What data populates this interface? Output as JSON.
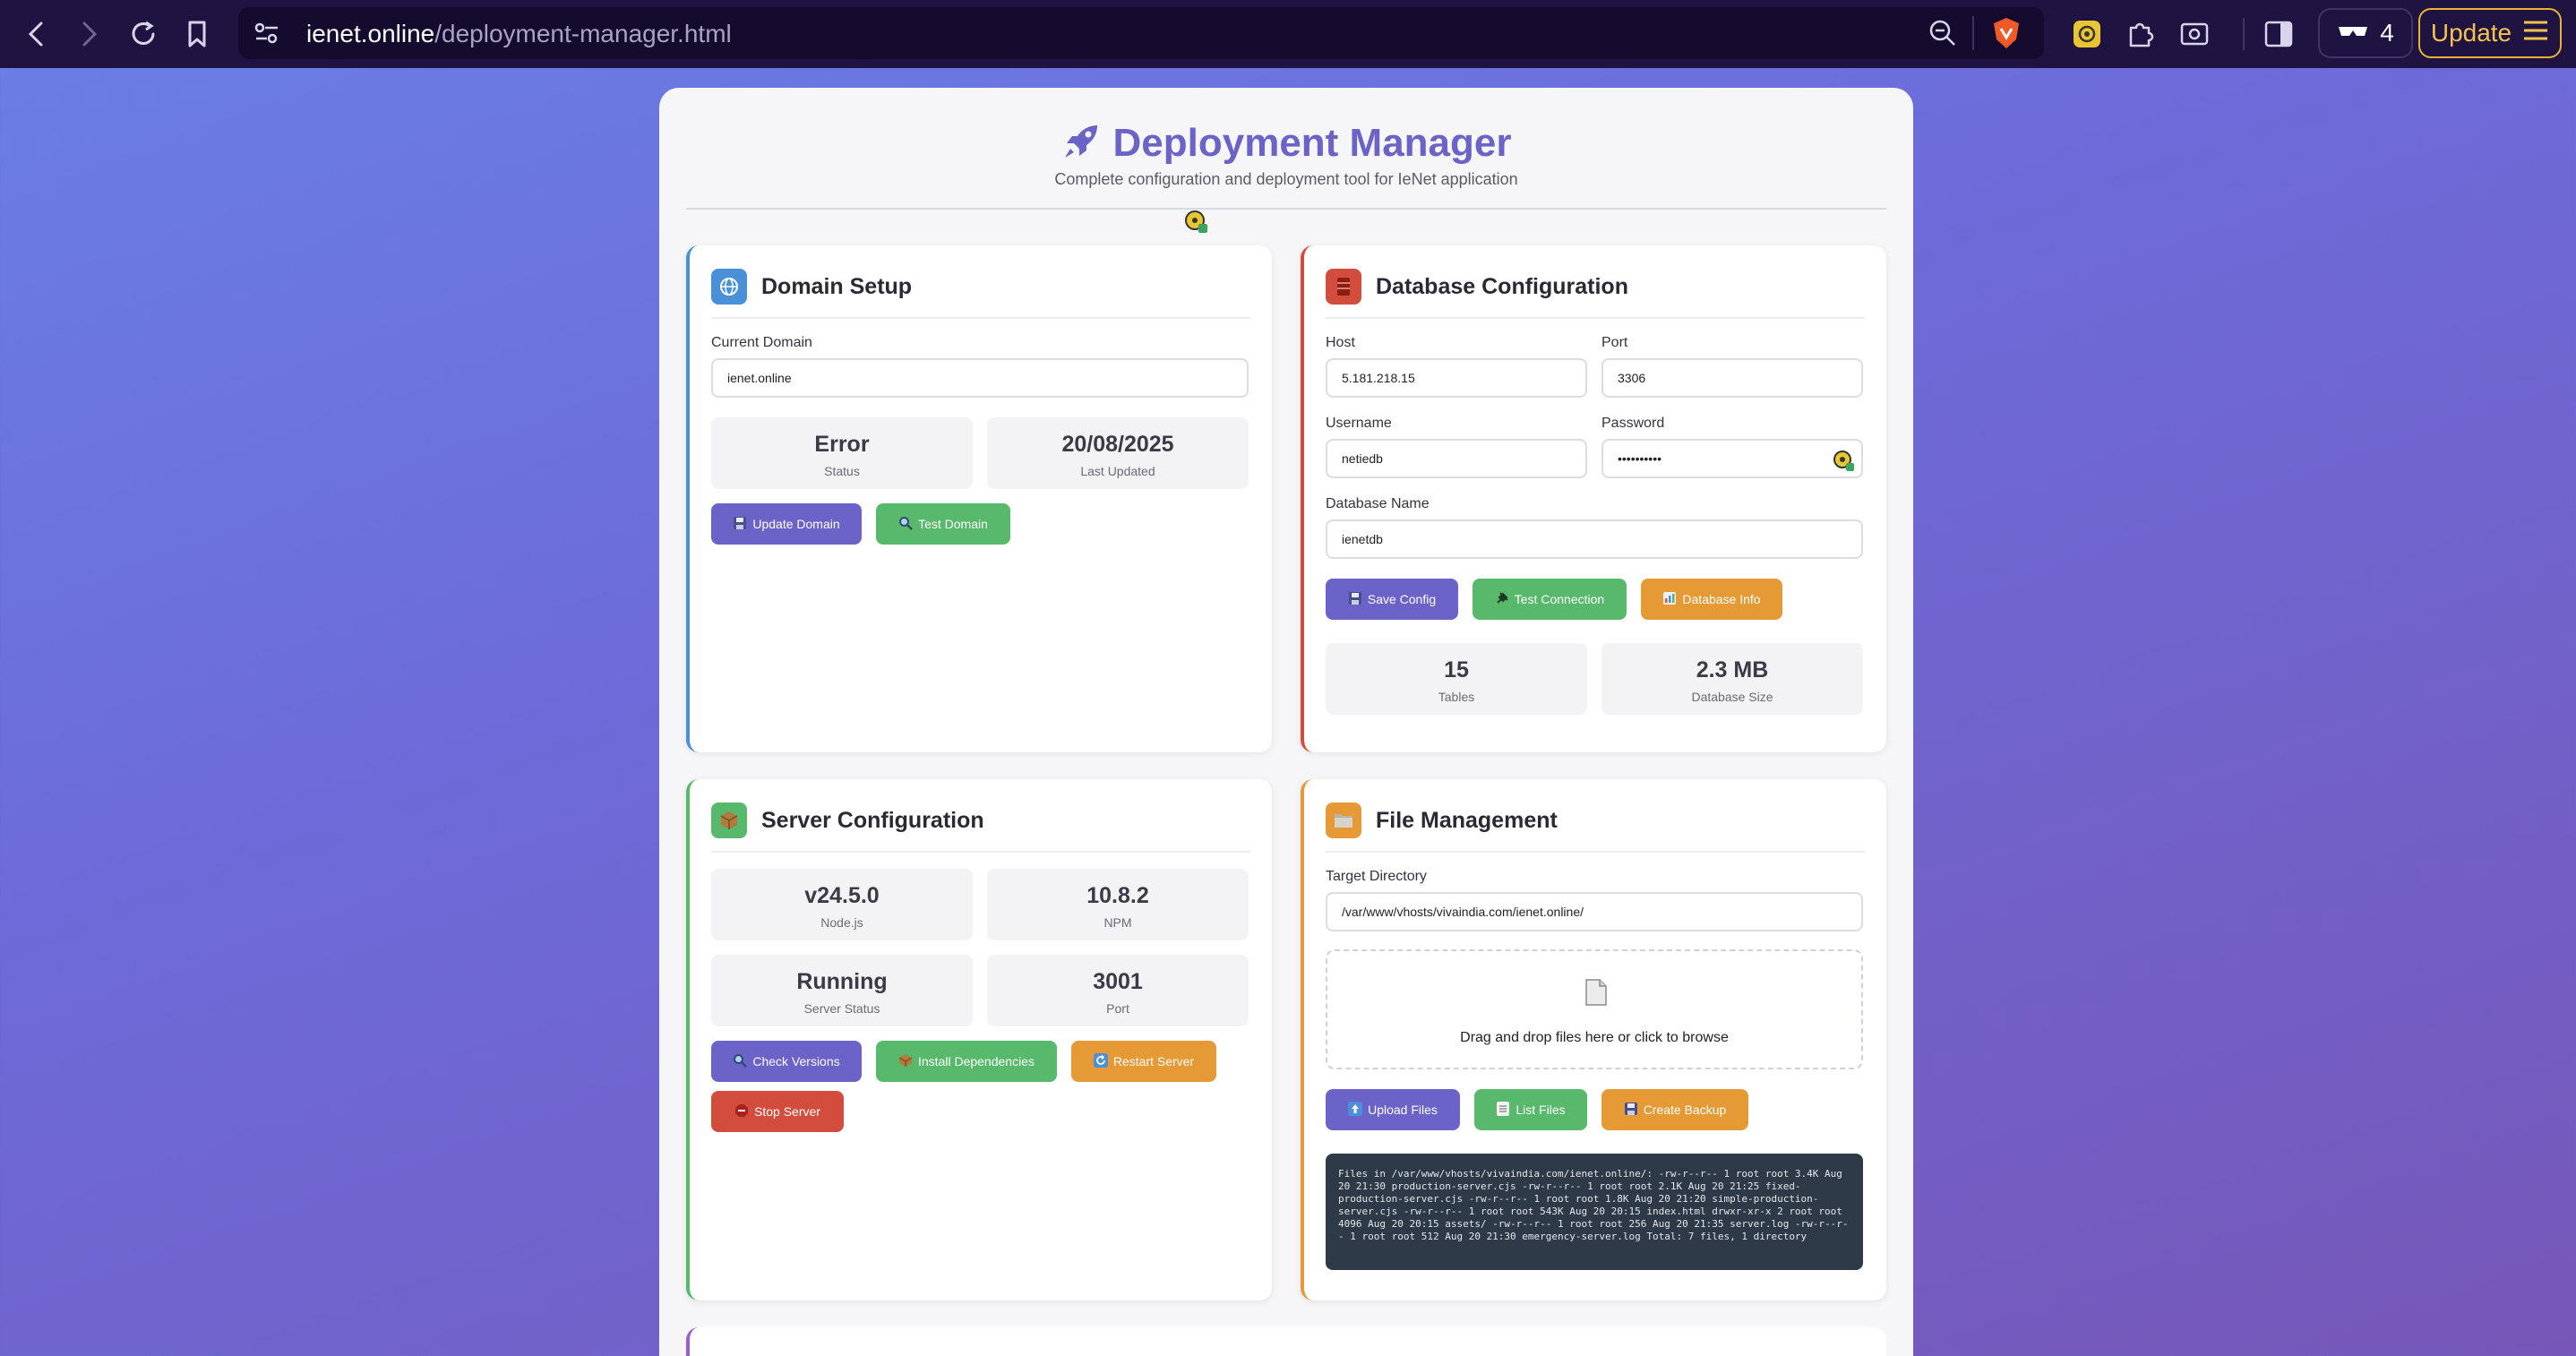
{
  "browser": {
    "url_host": "ienet.online",
    "url_path": "/deployment-manager.html",
    "glasses_count": "4",
    "update_label": "Update"
  },
  "header": {
    "title": "Deployment Manager",
    "subtitle": "Complete configuration and deployment tool for IeNet application"
  },
  "domain_setup": {
    "title": "Domain Setup",
    "current_domain_label": "Current Domain",
    "current_domain_value": "ienet.online",
    "status_value": "Error",
    "status_label": "Status",
    "updated_value": "20/08/2025",
    "updated_label": "Last Updated",
    "update_button": "Update Domain",
    "test_button": "Test Domain"
  },
  "database": {
    "title": "Database Configuration",
    "host_label": "Host",
    "host_value": "5.181.218.15",
    "port_label": "Port",
    "port_value": "3306",
    "username_label": "Username",
    "username_value": "netiedb",
    "password_label": "Password",
    "password_value": "••••••••••",
    "dbname_label": "Database Name",
    "dbname_value": "ienetdb",
    "save_button": "Save Config",
    "test_button": "Test Connection",
    "info_button": "Database Info",
    "tables_value": "15",
    "tables_label": "Tables",
    "size_value": "2.3 MB",
    "size_label": "Database Size"
  },
  "server": {
    "title": "Server Configuration",
    "node_value": "v24.5.0",
    "node_label": "Node.js",
    "npm_value": "10.8.2",
    "npm_label": "NPM",
    "status_value": "Running",
    "status_label": "Server Status",
    "port_value": "3001",
    "port_label": "Port",
    "check_button": "Check Versions",
    "install_button": "Install Dependencies",
    "restart_button": "Restart Server",
    "stop_button": "Stop Server"
  },
  "files": {
    "title": "File Management",
    "target_label": "Target Directory",
    "target_value": "/var/www/vhosts/vivaindia.com/ienet.online/",
    "drop_text": "Drag and drop files here or click to browse",
    "upload_button": "Upload Files",
    "list_button": "List Files",
    "backup_button": "Create Backup",
    "console_output": "Files in /var/www/vhosts/vivaindia.com/ienet.online/: -rw-r--r-- 1 root root 3.4K Aug 20 21:30 production-server.cjs -rw-r--r-- 1 root root 2.1K Aug 20 21:25 fixed-production-server.cjs -rw-r--r-- 1 root root 1.8K Aug 20 21:20 simple-production-server.cjs -rw-r--r-- 1 root root 543K Aug 20 20:15 index.html drwxr-xr-x 2 root root 4096 Aug 20 20:15 assets/ -rw-r--r-- 1 root root 256 Aug 20 21:35 server.log -rw-r--r-- 1 root root 512 Aug 20 21:30 emergency-server.log Total: 7 files, 1 directory"
  },
  "colors": {
    "accent": "#6b63c8",
    "success": "#58b86b",
    "warning": "#e59a35",
    "danger": "#d24d3d"
  }
}
